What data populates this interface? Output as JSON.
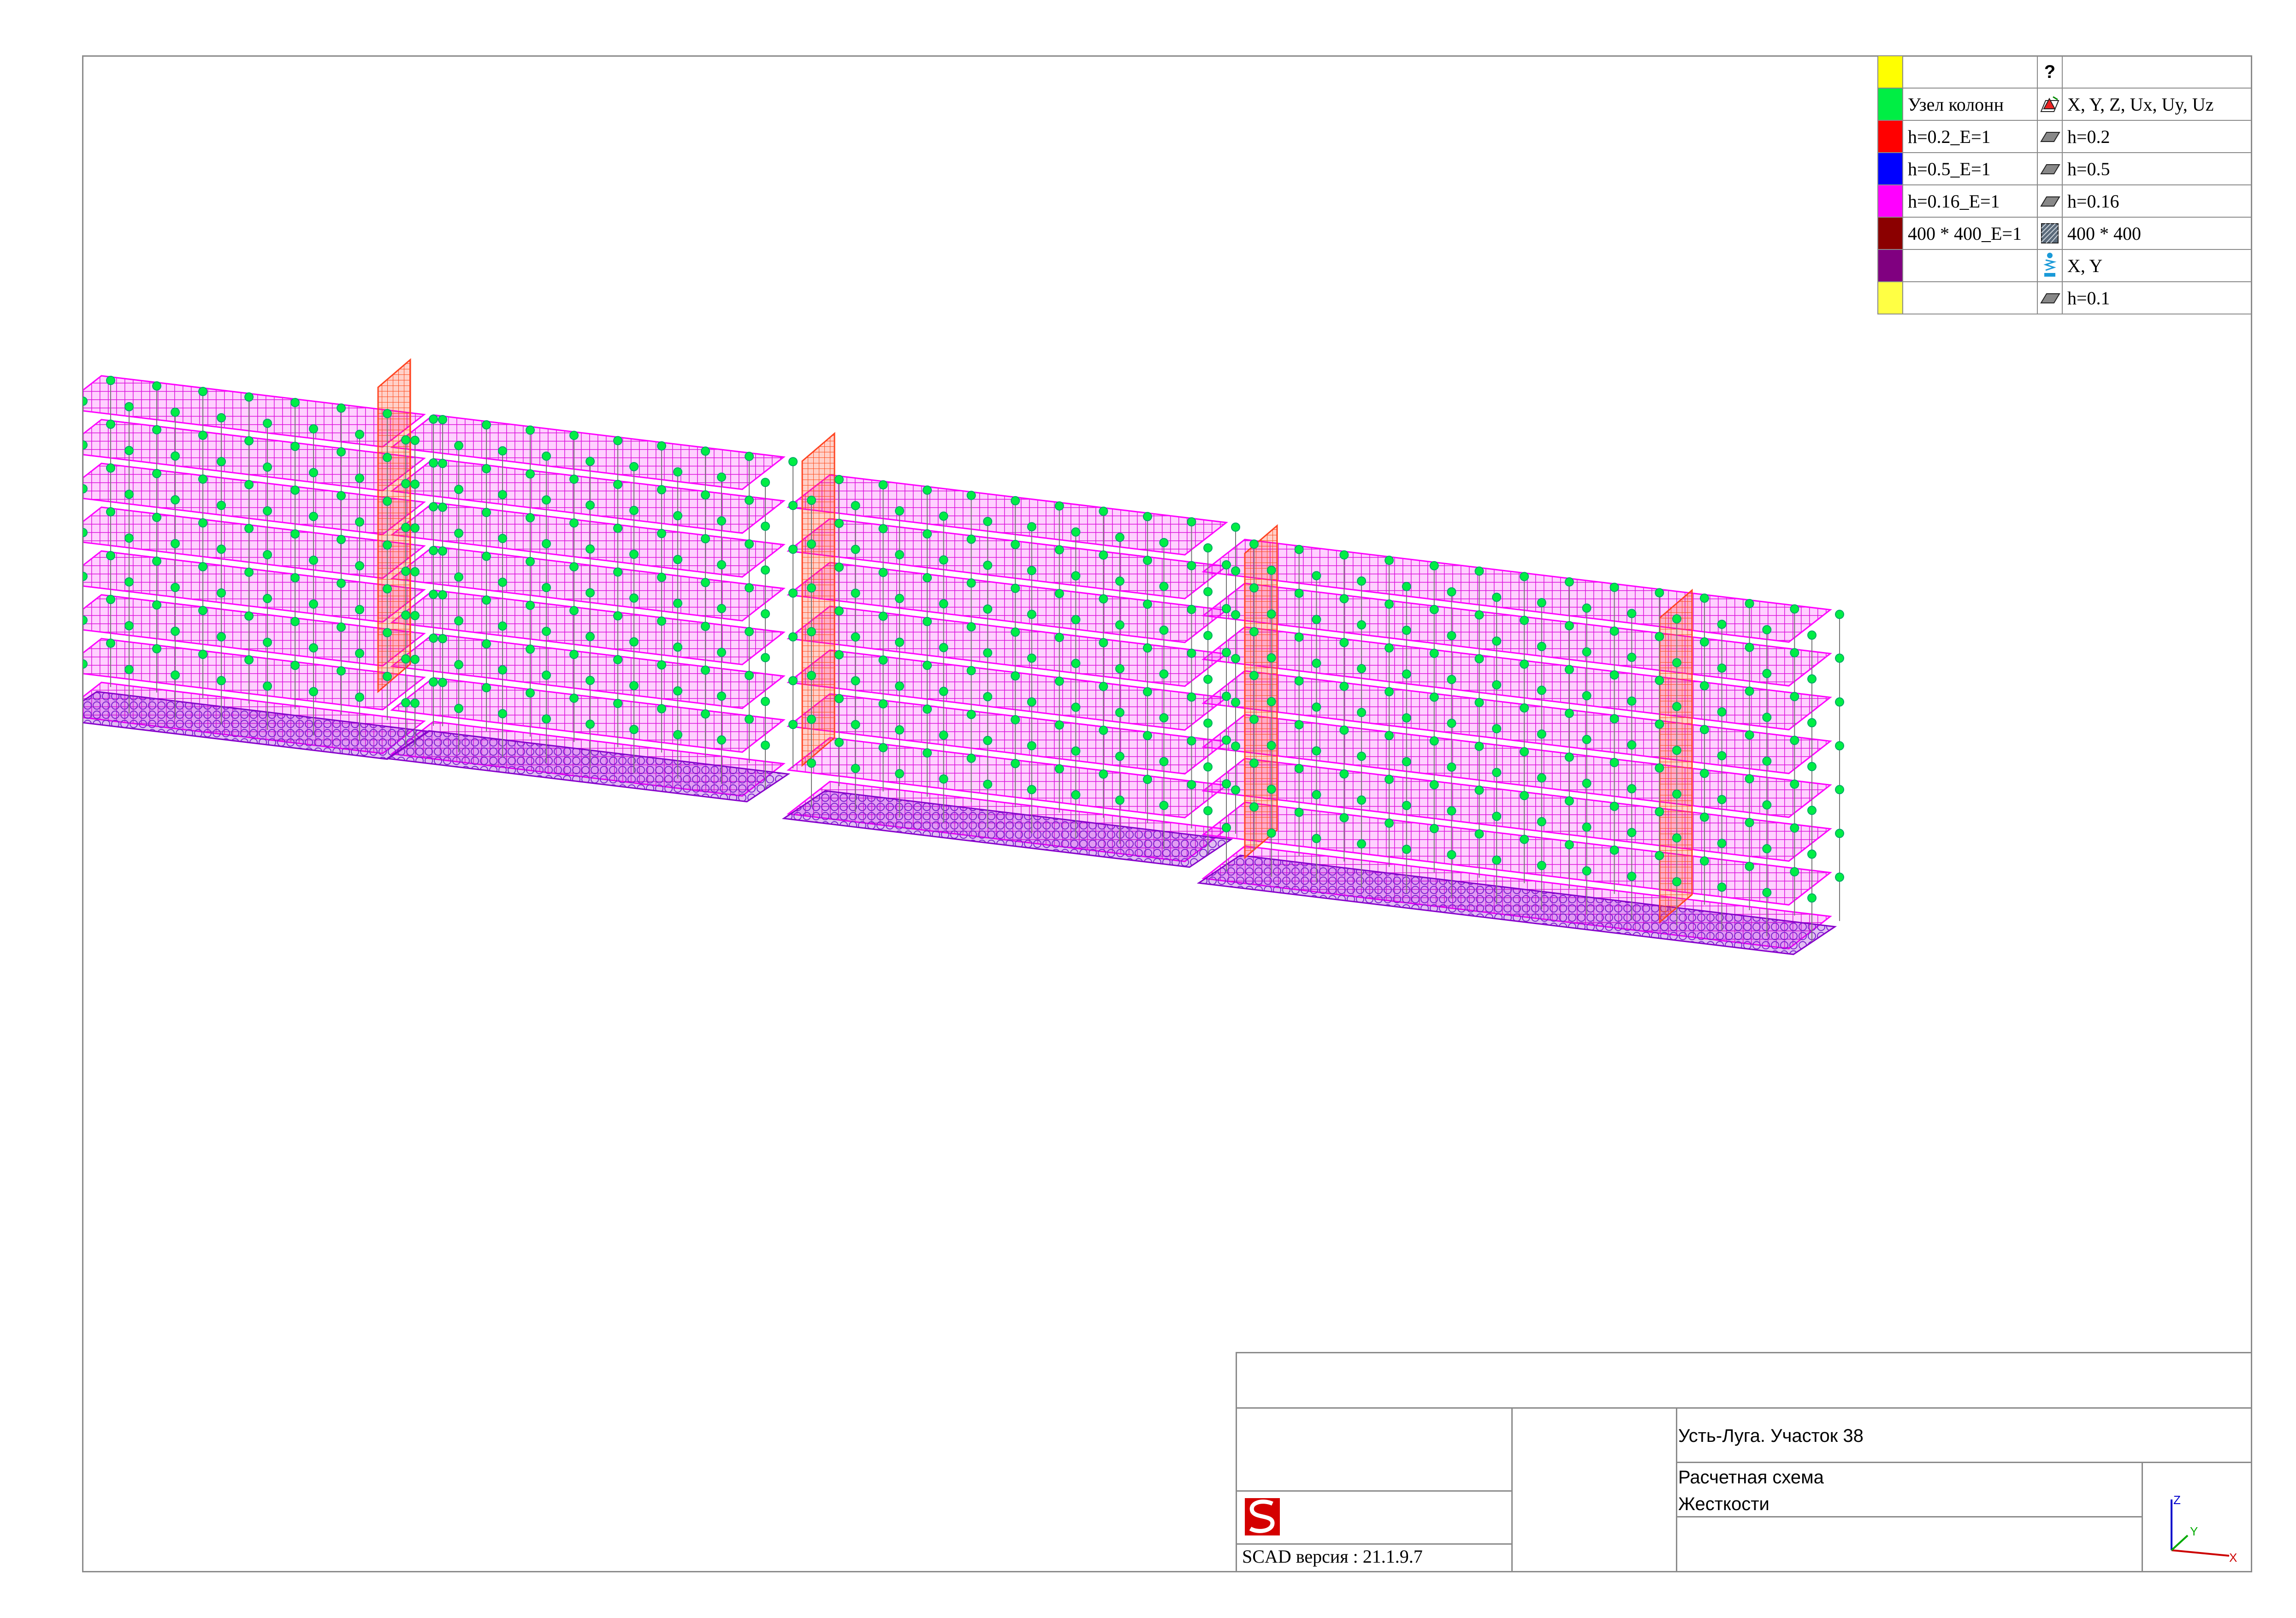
{
  "legend": {
    "header_icon": "?",
    "rows": [
      {
        "color": "#ffff00",
        "label": "",
        "icon": "",
        "value": ""
      },
      {
        "color": "#00ee44",
        "label": "Узел колонн",
        "icon": "node-constraint-icon",
        "value": "X, Y, Z, Ux, Uy, Uz"
      },
      {
        "color": "#ff0000",
        "label": "h=0.2_E=1",
        "icon": "plate-icon",
        "value": "h=0.2"
      },
      {
        "color": "#0000ff",
        "label": "h=0.5_E=1",
        "icon": "plate-icon",
        "value": "h=0.5"
      },
      {
        "color": "#ff00ff",
        "label": "h=0.16_E=1",
        "icon": "plate-icon",
        "value": "h=0.16"
      },
      {
        "color": "#8b0000",
        "label": "400 * 400_E=1",
        "icon": "column-section-icon",
        "value": "400 * 400"
      },
      {
        "color": "#800080",
        "label": "",
        "icon": "spring-support-icon",
        "value": "X, Y"
      },
      {
        "color": "#ffff44",
        "label": "",
        "icon": "plate-icon",
        "value": "h=0.1"
      }
    ]
  },
  "title_block": {
    "project": "Усть-Луга. Участок 38",
    "drawing_name": "Расчетная схема",
    "drawing_subject": "Жесткости",
    "software": "SCAD версия : 21.1.9.7"
  },
  "axes": {
    "x": "X",
    "y": "Y",
    "z": "Z"
  },
  "colors": {
    "slab": "#ff00ff",
    "slab_dense": "#e000e0",
    "foundation": "#8800cc",
    "node": "#00ee44",
    "wall": "#ff4422",
    "frame": "#8a8a8a"
  }
}
